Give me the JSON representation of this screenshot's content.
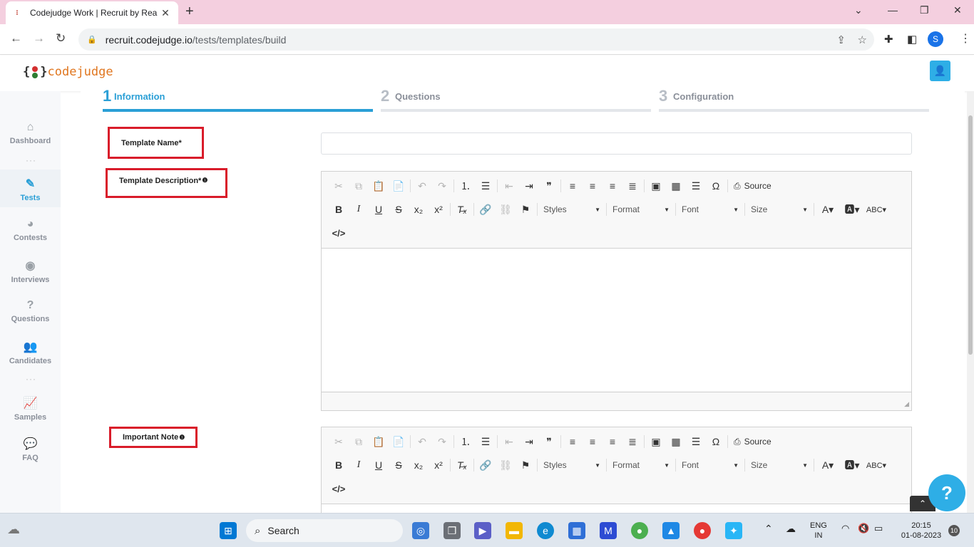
{
  "browser": {
    "tab_title": "Codejudge Work | Recruit by Rea",
    "url_host": "recruit.codejudge.io",
    "url_path": "/tests/templates/build",
    "profile_initial": "S"
  },
  "app": {
    "logo_open": "{",
    "logo_close": "}",
    "logo_text": "codejudge"
  },
  "sidebar": {
    "items": [
      {
        "label": "Dashboard",
        "icon": "home-icon"
      },
      {
        "label": "Tests",
        "icon": "pen-icon"
      },
      {
        "label": "Contests",
        "icon": "pie-chart-icon"
      },
      {
        "label": "Interviews",
        "icon": "podcast-icon"
      },
      {
        "label": "Questions",
        "icon": "question-icon"
      },
      {
        "label": "Candidates",
        "icon": "users-icon"
      },
      {
        "label": "Samples",
        "icon": "line-chart-icon"
      },
      {
        "label": "FAQ",
        "icon": "comments-icon"
      }
    ]
  },
  "steps": [
    {
      "num": "1",
      "label": "Information",
      "active": true
    },
    {
      "num": "2",
      "label": "Questions",
      "active": false
    },
    {
      "num": "3",
      "label": "Configuration",
      "active": false
    }
  ],
  "form": {
    "template_name_label": "Template Name*",
    "template_description_label": "Template Description*",
    "important_note_label": "Important Note",
    "info_mark": "❶",
    "template_name_value": ""
  },
  "editor": {
    "source_label": "Source",
    "styles_label": "Styles",
    "format_label": "Format",
    "font_label": "Font",
    "size_label": "Size"
  },
  "taskbar": {
    "search_label": "Search",
    "lang_top": "ENG",
    "lang_bottom": "IN",
    "time": "20:15",
    "date": "01-08-2023",
    "notif_count": "10"
  },
  "colors": {
    "accent": "#2a9fd6",
    "highlight_border": "#d91c2a",
    "tab_strip": "#f4cfdf"
  }
}
